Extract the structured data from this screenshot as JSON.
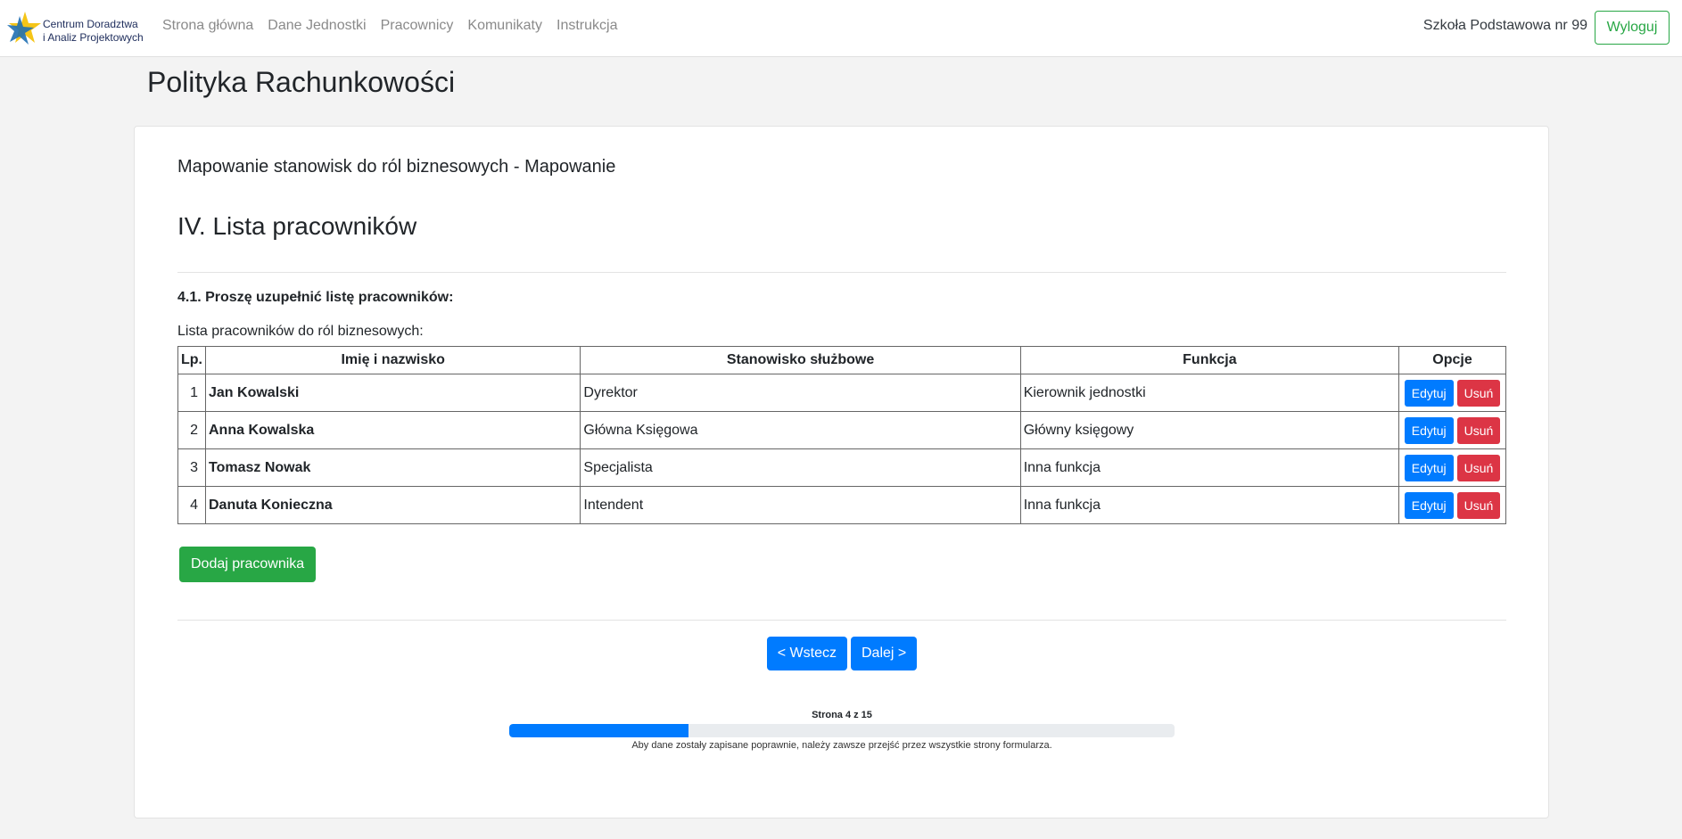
{
  "brand": {
    "line1": "Centrum Doradztwa",
    "line2": "i Analiz Projektowych"
  },
  "nav": {
    "items": [
      {
        "label": "Strona główna"
      },
      {
        "label": "Dane Jednostki"
      },
      {
        "label": "Pracownicy"
      },
      {
        "label": "Komunikaty"
      },
      {
        "label": "Instrukcja"
      }
    ],
    "school": "Szkoła Podstawowa nr 99",
    "logout": "Wyloguj"
  },
  "page": {
    "title": "Polityka Rachunkowości"
  },
  "card": {
    "subtitle": "Mapowanie stanowisk do ról biznesowych - Mapowanie",
    "section_title": "IV. Lista pracowników",
    "question": "4.1. Proszę uzupełnić listę pracowników:",
    "list_label": "Lista pracowników do ról biznesowych:"
  },
  "table": {
    "headers": [
      "Lp.",
      "Imię i nazwisko",
      "Stanowisko służbowe",
      "Funkcja",
      "Opcje"
    ],
    "rows": [
      {
        "lp": "1",
        "name": "Jan Kowalski",
        "position": "Dyrektor",
        "function": "Kierownik jednostki"
      },
      {
        "lp": "2",
        "name": "Anna Kowalska",
        "position": "Główna Księgowa",
        "function": "Główny księgowy"
      },
      {
        "lp": "3",
        "name": "Tomasz Nowak",
        "position": "Specjalista",
        "function": "Inna funkcja"
      },
      {
        "lp": "4",
        "name": "Danuta Konieczna",
        "position": "Intendent",
        "function": "Inna funkcja"
      }
    ],
    "edit_label": "Edytuj",
    "delete_label": "Usuń"
  },
  "actions": {
    "add_employee": "Dodaj pracownika",
    "back": "< Wstecz",
    "next": "Dalej >"
  },
  "progress": {
    "label": "Strona 4 z 15",
    "fraction": 0.27,
    "note": "Aby dane zostały zapisane poprawnie, należy zawsze przejść przez wszystkie strony formularza."
  },
  "colors": {
    "primary": "#007bff",
    "success": "#28a745",
    "danger": "#dc3545"
  }
}
